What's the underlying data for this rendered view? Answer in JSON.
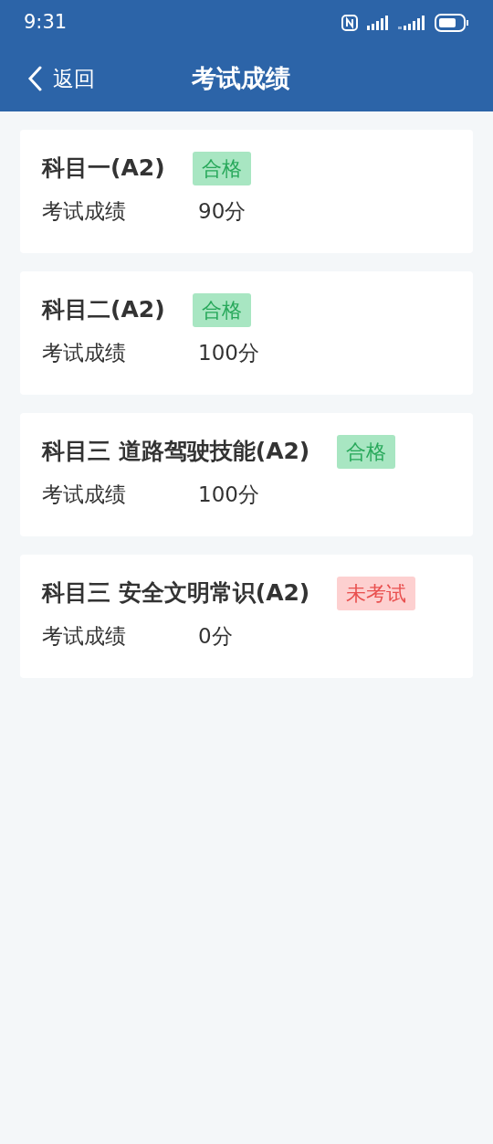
{
  "status_bar": {
    "time": "9:31"
  },
  "header": {
    "back": "返回",
    "title": "考试成绩"
  },
  "results": [
    {
      "subject": "科目一(A2)",
      "badge": {
        "text": "合格",
        "kind": "pass"
      },
      "label": "考试成绩",
      "score": "90分"
    },
    {
      "subject": "科目二(A2)",
      "badge": {
        "text": "合格",
        "kind": "pass"
      },
      "label": "考试成绩",
      "score": "100分"
    },
    {
      "subject": "科目三 道路驾驶技能(A2)",
      "badge": {
        "text": "合格",
        "kind": "pass"
      },
      "label": "考试成绩",
      "score": "100分"
    },
    {
      "subject": "科目三 安全文明常识(A2)",
      "badge": {
        "text": "未考试",
        "kind": "absent"
      },
      "label": "考试成绩",
      "score": "0分"
    }
  ]
}
